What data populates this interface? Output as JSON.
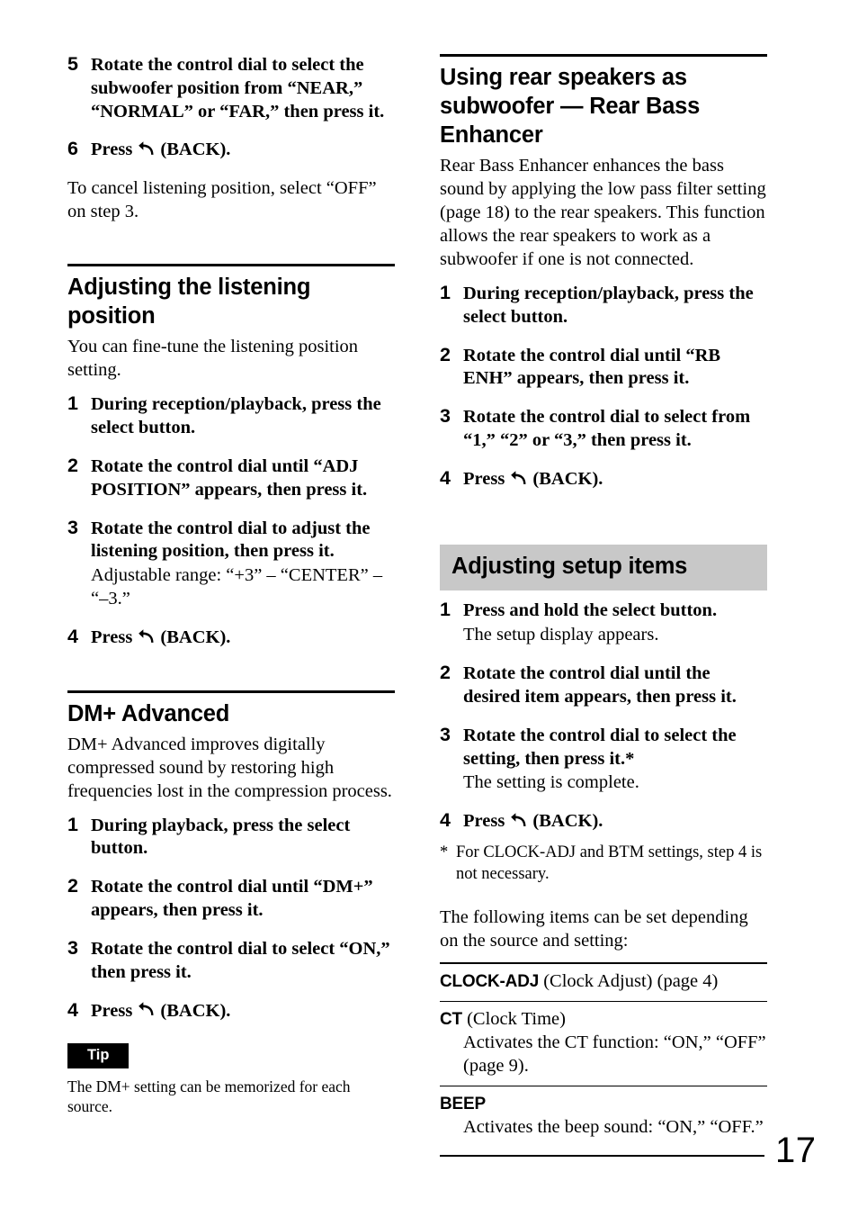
{
  "page_number": "17",
  "icons": {
    "back": "back-arrow-icon"
  },
  "left_column": {
    "continued_steps": [
      {
        "num": "5",
        "text": "Rotate the control dial to select the subwoofer position from “NEAR,” “NORMAL” or “FAR,” then press it."
      },
      {
        "num": "6",
        "text_before": "Press",
        "text_after": "(BACK).",
        "has_back_icon": true
      }
    ],
    "cancel_note": "To cancel listening position, select “OFF” on step 3.",
    "section_listening": {
      "heading": "Adjusting the listening position",
      "intro": "You can fine-tune the listening position setting.",
      "steps": [
        {
          "num": "1",
          "text": "During reception/playback, press the select button."
        },
        {
          "num": "2",
          "text": "Rotate the control dial until “ADJ POSITION” appears, then press it."
        },
        {
          "num": "3",
          "text": "Rotate the control dial to adjust the listening position, then press it.",
          "sub": "Adjustable range: “+3” – “CENTER” – “–3.”"
        },
        {
          "num": "4",
          "text_before": "Press",
          "text_after": "(BACK).",
          "has_back_icon": true
        }
      ]
    },
    "section_dm": {
      "heading": "DM+ Advanced",
      "intro": "DM+ Advanced improves digitally compressed sound by restoring high frequencies lost in the compression process.",
      "steps": [
        {
          "num": "1",
          "text": "During playback, press the select button."
        },
        {
          "num": "2",
          "text": "Rotate the control dial until “DM+” appears, then press it."
        },
        {
          "num": "3",
          "text": "Rotate the control dial to select “ON,” then press it."
        },
        {
          "num": "4",
          "text_before": "Press",
          "text_after": "(BACK).",
          "has_back_icon": true
        }
      ],
      "tip_label": "Tip",
      "tip_body": "The DM+ setting can be memorized for each source."
    }
  },
  "right_column": {
    "section_rbe": {
      "heading": "Using rear speakers as subwoofer — Rear Bass Enhancer",
      "intro": "Rear Bass Enhancer enhances the bass sound by applying the low pass filter setting (page 18) to the rear speakers. This function allows the rear speakers to work as a subwoofer if one is not connected.",
      "steps": [
        {
          "num": "1",
          "text": "During reception/playback, press the select button."
        },
        {
          "num": "2",
          "text": "Rotate the control dial until “RB ENH” appears, then press it."
        },
        {
          "num": "3",
          "text": "Rotate the control dial to select from “1,” “2” or “3,” then press it."
        },
        {
          "num": "4",
          "text_before": "Press",
          "text_after": "(BACK).",
          "has_back_icon": true
        }
      ]
    },
    "section_setup": {
      "heading": "Adjusting setup items",
      "steps": [
        {
          "num": "1",
          "text": "Press and hold the select button.",
          "sub": "The setup display appears."
        },
        {
          "num": "2",
          "text": "Rotate the control dial until the desired item appears, then press it."
        },
        {
          "num": "3",
          "text": "Rotate the control dial to select the setting, then press it.*",
          "sub": "The setting is complete."
        },
        {
          "num": "4",
          "text_before": "Press",
          "text_after": "(BACK).",
          "has_back_icon": true
        }
      ],
      "footnote_marker": "*",
      "footnote": "For CLOCK-ADJ and BTM settings, step 4 is not necessary.",
      "list_intro": "The following items can be set depending on the source and setting:",
      "items": [
        {
          "term": "CLOCK-ADJ",
          "inline": " (Clock Adjust) (page 4)",
          "desc": ""
        },
        {
          "term": "CT",
          "inline": " (Clock Time)",
          "desc": "Activates the CT function: “ON,” “OFF” (page 9)."
        },
        {
          "term": "BEEP",
          "inline": "",
          "desc": "Activates the beep sound: “ON,” “OFF.”"
        }
      ]
    }
  }
}
